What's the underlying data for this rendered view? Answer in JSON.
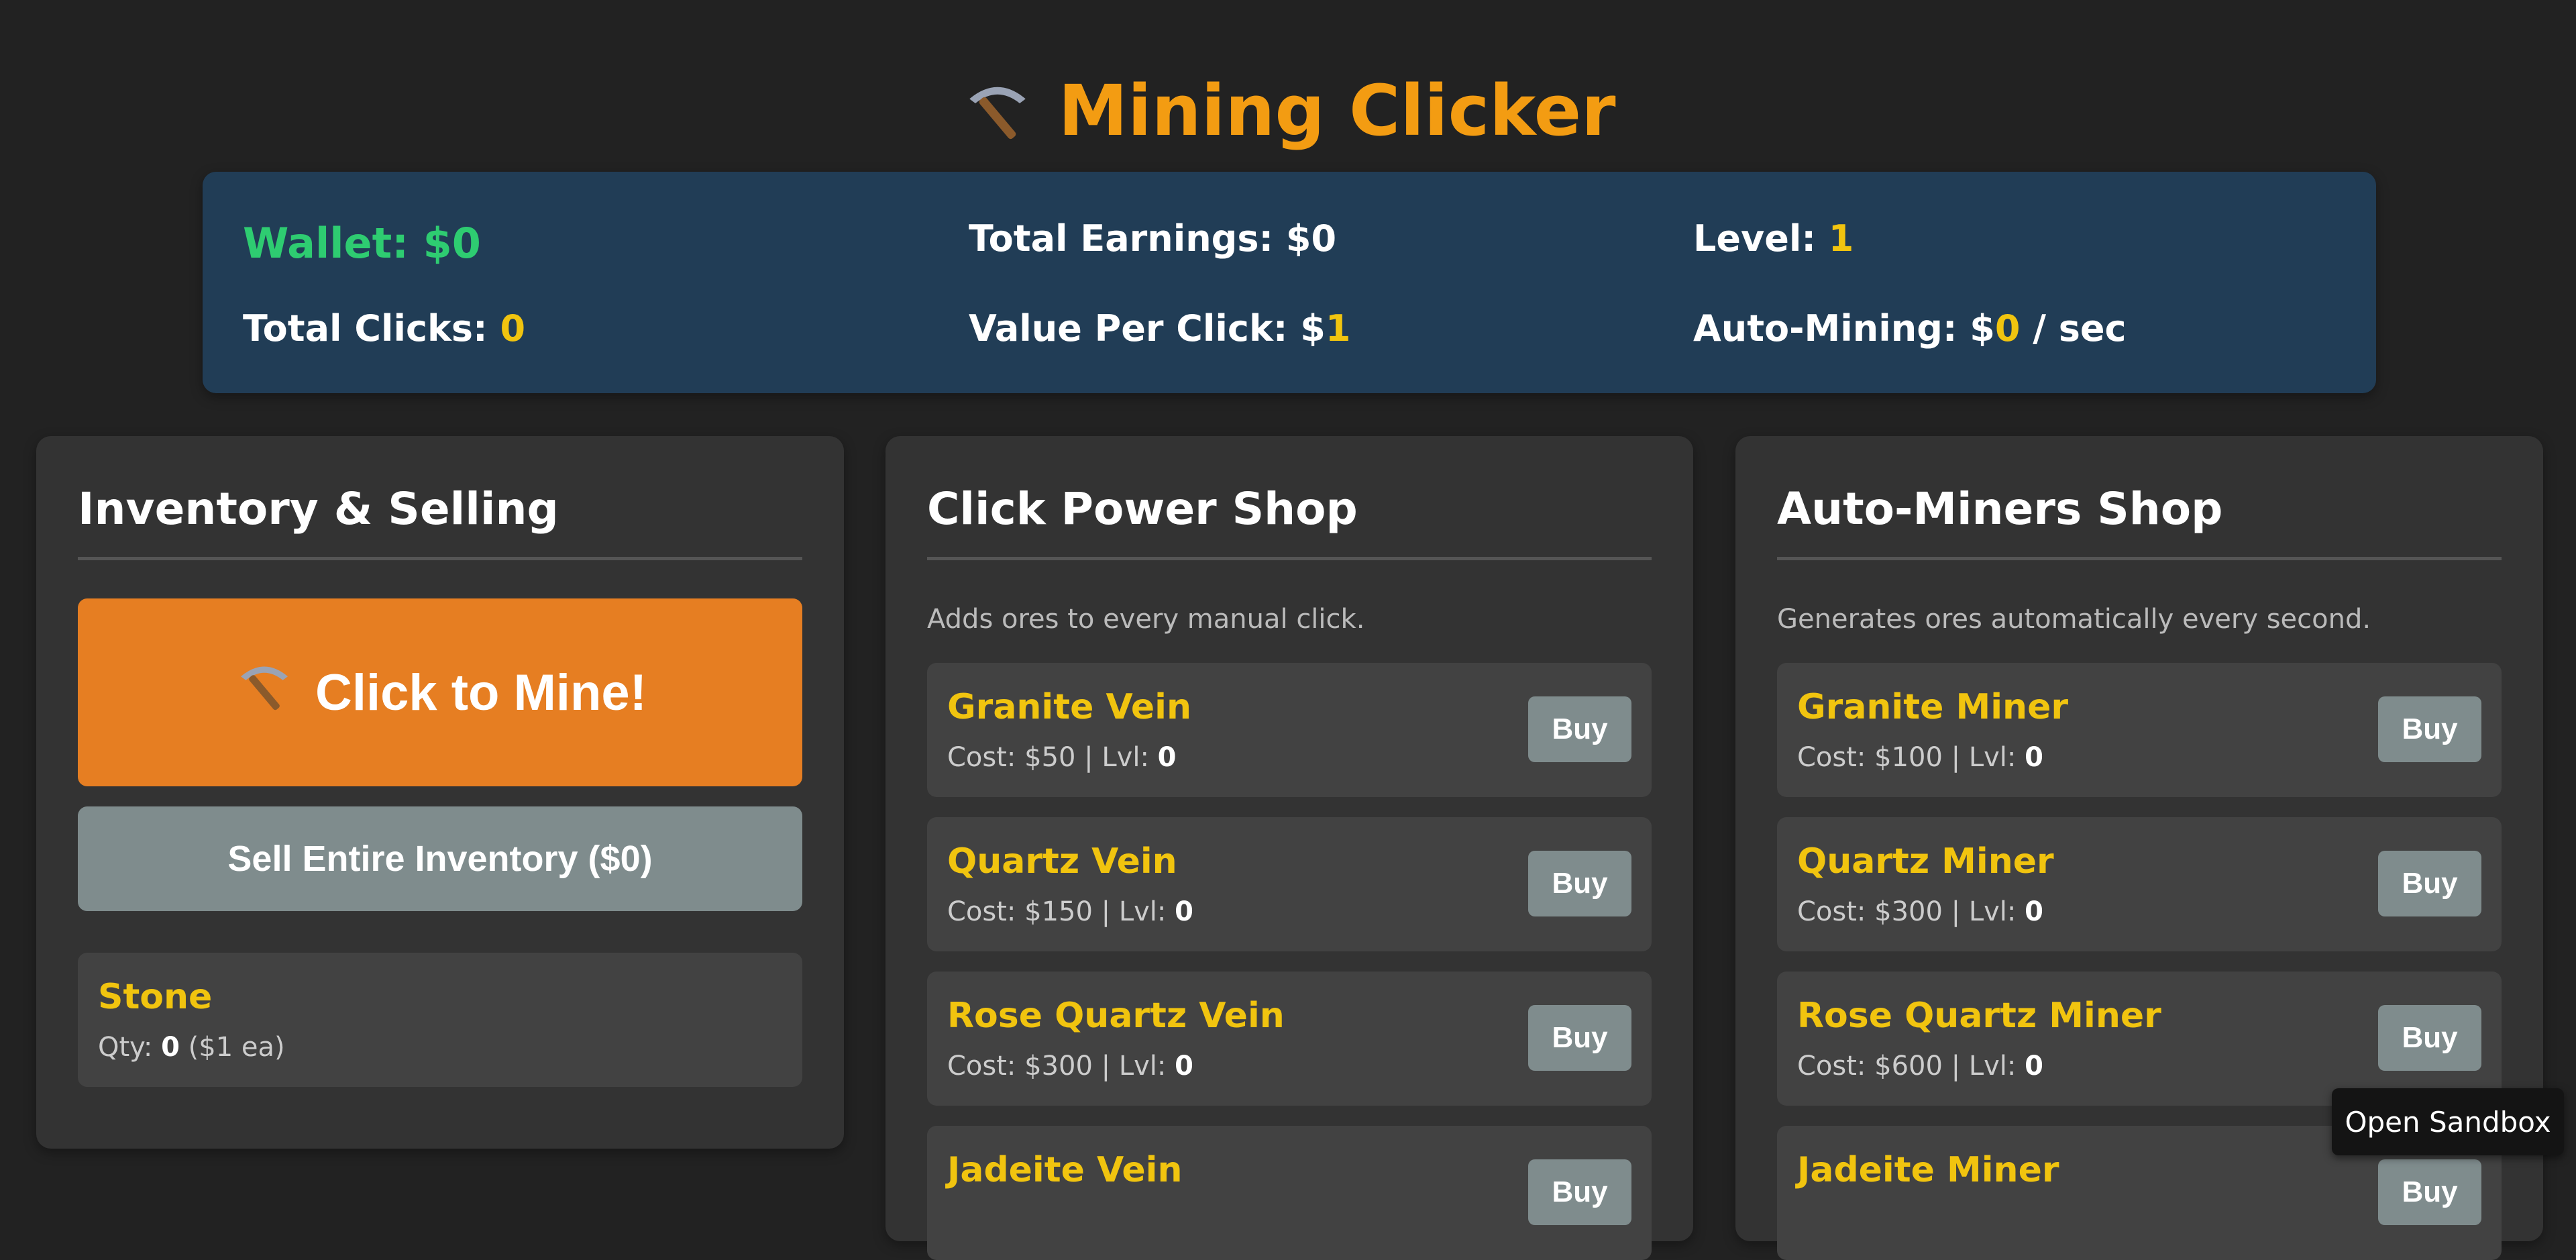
{
  "app": {
    "title": "Mining Clicker",
    "title_icon": "pickaxe-icon",
    "accent_color": "#f39c12"
  },
  "stats": {
    "wallet_label": "Wallet: $",
    "wallet_value": "0",
    "total_earnings_label": "Total Earnings: $",
    "total_earnings_value": "0",
    "level_label": "Level: ",
    "level_value": "1",
    "total_clicks_label": "Total Clicks: ",
    "total_clicks_value": "0",
    "value_per_click_label": "Value Per Click: $",
    "value_per_click_value": "1",
    "auto_mining_label": "Auto-Mining: $",
    "auto_mining_value": "0",
    "auto_mining_unit": " / sec"
  },
  "inventory": {
    "title": "Inventory & Selling",
    "mine_button_label": "Click to Mine!",
    "sell_button_label": "Sell Entire Inventory ($0)",
    "ores": [
      {
        "name": "Stone",
        "qty_label": "Qty: ",
        "qty": "0",
        "price_note": " ($1 ea)"
      }
    ]
  },
  "click_shop": {
    "title": "Click Power Shop",
    "description": "Adds ores to every manual click.",
    "items": [
      {
        "name": "Granite Vein",
        "cost_text": "Cost: $50 | Lvl: ",
        "level": "0",
        "buy_label": "Buy"
      },
      {
        "name": "Quartz Vein",
        "cost_text": "Cost: $150 | Lvl: ",
        "level": "0",
        "buy_label": "Buy"
      },
      {
        "name": "Rose Quartz Vein",
        "cost_text": "Cost: $300 | Lvl: ",
        "level": "0",
        "buy_label": "Buy"
      },
      {
        "name": "Jadeite Vein",
        "cost_text": "",
        "level": "",
        "buy_label": "Buy"
      }
    ]
  },
  "auto_shop": {
    "title": "Auto-Miners Shop",
    "description": "Generates ores automatically every second.",
    "items": [
      {
        "name": "Granite Miner",
        "cost_text": "Cost: $100 | Lvl: ",
        "level": "0",
        "buy_label": "Buy"
      },
      {
        "name": "Quartz Miner",
        "cost_text": "Cost: $300 | Lvl: ",
        "level": "0",
        "buy_label": "Buy"
      },
      {
        "name": "Rose Quartz Miner",
        "cost_text": "Cost: $600 | Lvl: ",
        "level": "0",
        "buy_label": "Buy"
      },
      {
        "name": "Jadeite Miner",
        "cost_text": "",
        "level": "",
        "buy_label": "Buy"
      }
    ]
  },
  "sandbox_button_label": "Open Sandbox"
}
